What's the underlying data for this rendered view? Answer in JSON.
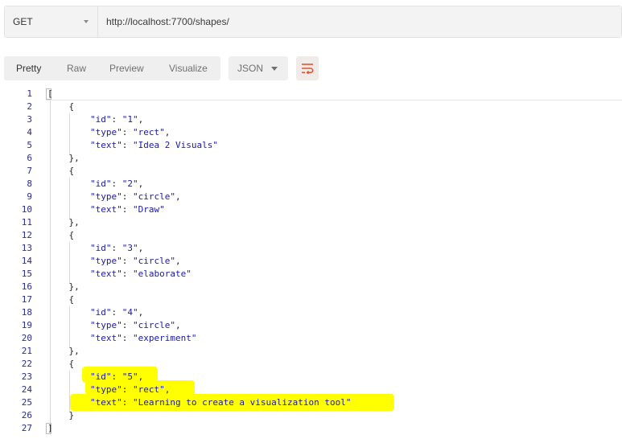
{
  "request": {
    "method": "GET",
    "url": "http://localhost:7700/shapes/"
  },
  "response_toolbar": {
    "tabs": [
      "Pretty",
      "Raw",
      "Preview",
      "Visualize"
    ],
    "active_tab": "Pretty",
    "format": "JSON",
    "wrap_icon": "wrap-lines-icon"
  },
  "colors": {
    "highlight": "#ffff00",
    "wrap_accent": "#e8542f",
    "line_number": "#2b2b8f",
    "string": "#1a1aa6"
  },
  "code": {
    "line_numbers": [
      "1",
      "2",
      "3",
      "4",
      "5",
      "6",
      "7",
      "8",
      "9",
      "10",
      "11",
      "12",
      "13",
      "14",
      "15",
      "16",
      "17",
      "18",
      "19",
      "20",
      "21",
      "22",
      "23",
      "24",
      "25",
      "26",
      "27"
    ],
    "lines": [
      "[",
      "    {",
      "        \"id\": \"1\",",
      "        \"type\": \"rect\",",
      "        \"text\": \"Idea 2 Visuals\"",
      "    },",
      "    {",
      "        \"id\": \"2\",",
      "        \"type\": \"circle\",",
      "        \"text\": \"Draw\"",
      "    },",
      "    {",
      "        \"id\": \"3\",",
      "        \"type\": \"circle\",",
      "        \"text\": \"elaborate\"",
      "    },",
      "    {",
      "        \"id\": \"4\",",
      "        \"type\": \"circle\",",
      "        \"text\": \"experiment\"",
      "    },",
      "    {",
      "        \"id\": \"5\",",
      "        \"type\": \"rect\",",
      "        \"text\": \"Learning to create a visualization tool\"",
      "    }",
      "]"
    ]
  }
}
